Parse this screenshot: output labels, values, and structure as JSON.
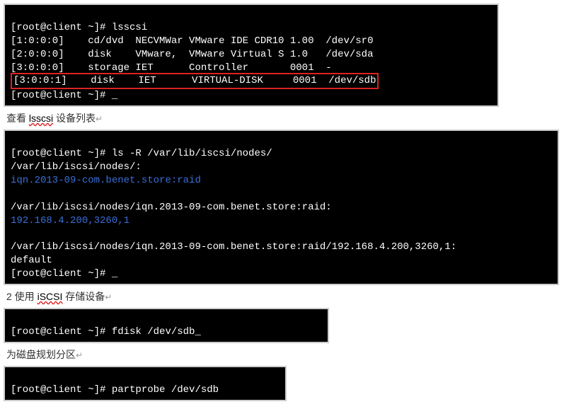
{
  "terminal1": {
    "prompt1": "[root@client ~]# ",
    "cmd1": "lsscsi",
    "row1": "[1:0:0:0]    cd/dvd  NECVMWar VMware IDE CDR10 1.00  /dev/sr0",
    "row2": "[2:0:0:0]    disk    VMware,  VMware Virtual S 1.0   /dev/sda",
    "row3": "[3:0:0:0]    storage IET      Controller       0001  -",
    "row4": "[3:0:0:1]    disk    IET      VIRTUAL-DISK     0001  /dev/sdb",
    "prompt2": "[root@client ~]# ",
    "cursor": "_"
  },
  "caption1": {
    "pre": "查看 ",
    "ul": "lsscsi",
    "post": " 设备列表",
    "arrow": "↵"
  },
  "terminal2": {
    "prompt1": "[root@client ~]# ",
    "cmd1": "ls -R /var/lib/iscsi/nodes/",
    "line1": "/var/lib/iscsi/nodes/:",
    "blue1": "iqn.2013-09-com.benet.store:raid",
    "blank1": " ",
    "line2": "/var/lib/iscsi/nodes/iqn.2013-09-com.benet.store:raid:",
    "blue2": "192.168.4.200,3260,1",
    "blank2": " ",
    "line3": "/var/lib/iscsi/nodes/iqn.2013-09-com.benet.store:raid/192.168.4.200,3260,1:",
    "line4": "default",
    "prompt2": "[root@client ~]# ",
    "cursor": "_"
  },
  "caption2": {
    "pre": "2 使用 ",
    "ul": "iSCSI",
    "post": " 存储设备",
    "arrow": "↵"
  },
  "terminal3": {
    "prompt": "[root@client ~]# ",
    "cmd": "fdisk /dev/sdb",
    "cursor": "_"
  },
  "caption3": {
    "text": "为磁盘规划分区",
    "arrow": "↵"
  },
  "terminal4": {
    "prompt": "[root@client ~]# ",
    "cmd": "partprobe /dev/sdb"
  }
}
